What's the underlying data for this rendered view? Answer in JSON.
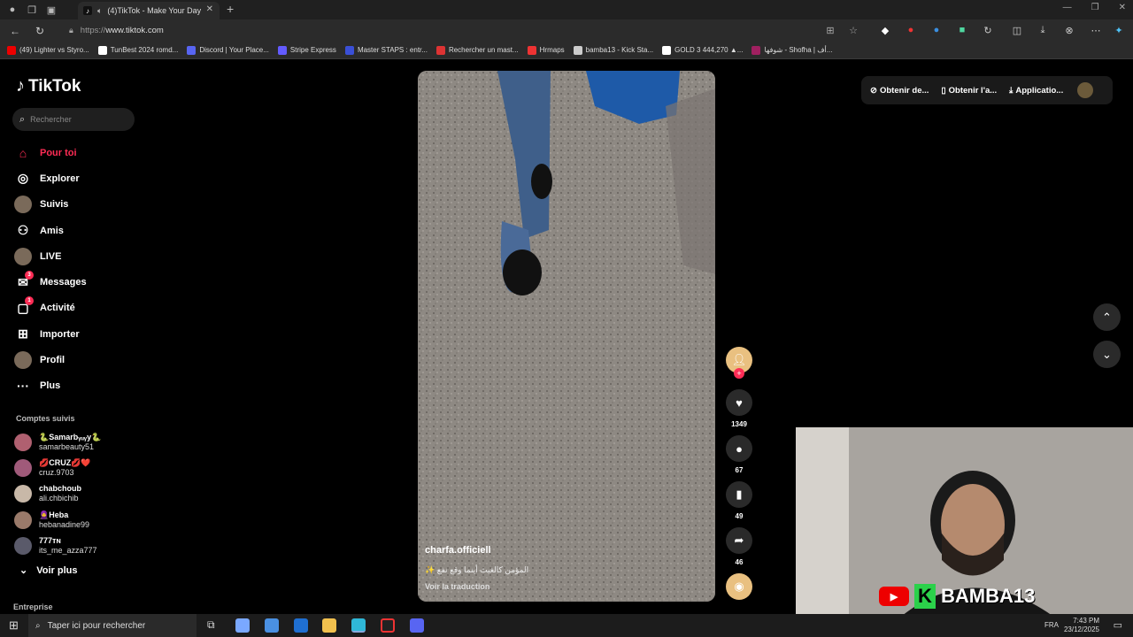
{
  "browser": {
    "tab_title": "(4)TikTok - Make Your Day",
    "url_prefix": "https://",
    "url_host": "www.tiktok.com",
    "bookmarks": [
      {
        "label": "(49) Lighter vs Styro...",
        "color": "#e00"
      },
      {
        "label": "TunBest 2024 romd...",
        "color": "#fff"
      },
      {
        "label": "Discord | Your Place...",
        "color": "#5865f2"
      },
      {
        "label": "Stripe Express",
        "color": "#635bff"
      },
      {
        "label": "Master STAPS : entr...",
        "color": "#3a4fd6"
      },
      {
        "label": "Rechercher un mast...",
        "color": "#d33"
      },
      {
        "label": "Hrmaps",
        "color": "#e33"
      },
      {
        "label": "bamba13 - Kick Sta...",
        "color": "#ccc"
      },
      {
        "label": "GOLD 3 444,270 ▲...",
        "color": "#fff"
      },
      {
        "label": "شوفها - Shofha | أف...",
        "color": "#a02060"
      }
    ]
  },
  "tiktok": {
    "logo": "TikTok",
    "search_placeholder": "Rechercher",
    "menu": [
      {
        "label": "Pour toi",
        "icon": "home-icon",
        "glyph": "⌂",
        "active": true
      },
      {
        "label": "Explorer",
        "icon": "compass-icon",
        "glyph": "◎"
      },
      {
        "label": "Suivis",
        "icon": "avatar",
        "glyph": ""
      },
      {
        "label": "Amis",
        "icon": "friends-icon",
        "glyph": "⚇"
      },
      {
        "label": "LIVE",
        "icon": "avatar",
        "glyph": ""
      },
      {
        "label": "Messages",
        "icon": "message-icon",
        "glyph": "✉",
        "badge": "3"
      },
      {
        "label": "Activité",
        "icon": "activity-icon",
        "glyph": "▢",
        "badge": "1"
      },
      {
        "label": "Importer",
        "icon": "upload-icon",
        "glyph": "⊞"
      },
      {
        "label": "Profil",
        "icon": "avatar",
        "glyph": ""
      },
      {
        "label": "Plus",
        "icon": "more-icon",
        "glyph": "···"
      }
    ],
    "followed_title": "Comptes suivis",
    "followed": [
      {
        "name": "🐍Samarbᵧᵤᵧy🐍",
        "handle": "samarbeauty51"
      },
      {
        "name": "💋CRUZ💋❤️",
        "handle": "cruz.9703"
      },
      {
        "name": "chabchoub",
        "handle": "ali.chbichib"
      },
      {
        "name": "🧕Heba",
        "handle": "hebanadine99"
      },
      {
        "name": "777ᴛɴ",
        "handle": "its_me_azza777"
      }
    ],
    "voir_plus": "Voir plus",
    "entreprise": "Entreprise",
    "video": {
      "username": "charfa.officiell",
      "caption": "✨ المؤمن كالغيث أينما وقع نفع",
      "translate": "Voir la traduction"
    },
    "actions": {
      "likes": "1349",
      "comments": "67",
      "saves": "49",
      "shares": "46"
    },
    "top_right": {
      "coins": "Obtenir de...",
      "app": "Obtenir l'a...",
      "install": "Applicatio..."
    }
  },
  "stream": {
    "name": "BAMBA13"
  },
  "taskbar": {
    "search": "Taper ici pour rechercher",
    "lang": "FRA",
    "time": "7:43 PM",
    "date": "23/12/2025"
  }
}
